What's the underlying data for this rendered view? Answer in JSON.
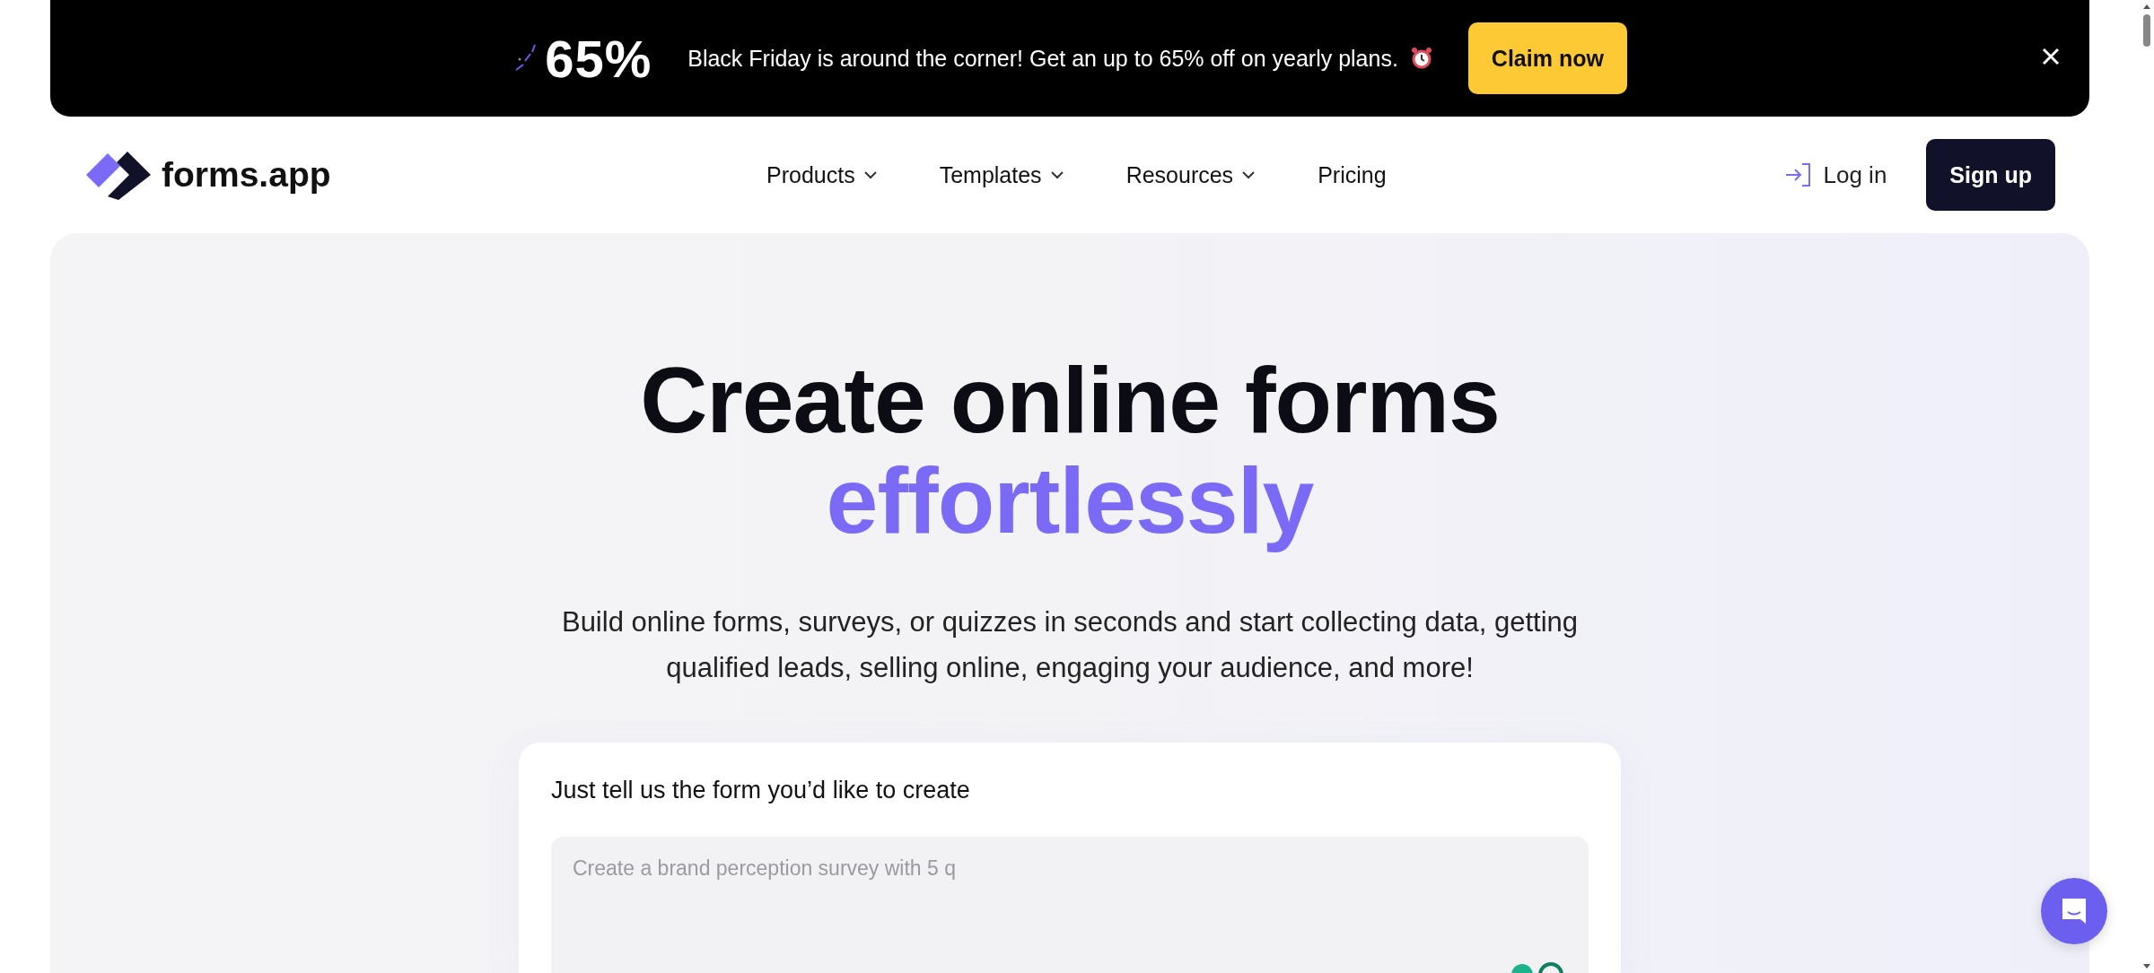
{
  "banner": {
    "badge": "65%",
    "message": "Black Friday is around the corner! Get an up to 65% off on yearly plans.",
    "button": "Claim now"
  },
  "header": {
    "logo": "forms.app",
    "nav": [
      {
        "label": "Products",
        "dropdown": true
      },
      {
        "label": "Templates",
        "dropdown": true
      },
      {
        "label": "Resources",
        "dropdown": true
      },
      {
        "label": "Pricing",
        "dropdown": false
      }
    ],
    "login": "Log in",
    "signup": "Sign up"
  },
  "hero": {
    "title": "Create online forms",
    "highlight": "effortlessly",
    "subtitle": "Build online forms, surveys, or quizzes in seconds and start collecting data, getting qualified leads, selling online, engaging your audience, and more!",
    "prompt": {
      "label": "Just tell us the form you’d like to create",
      "placeholder": "Create a brand perception survey with 5 q"
    }
  }
}
